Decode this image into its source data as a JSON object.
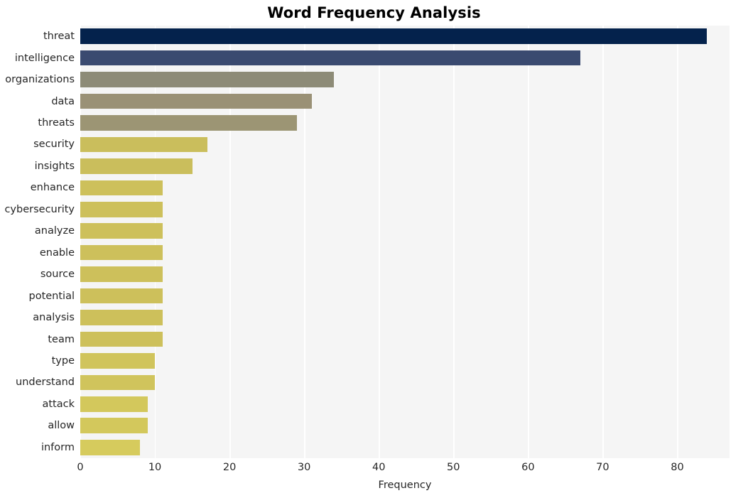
{
  "chart_data": {
    "type": "bar",
    "orientation": "horizontal",
    "title": "Word Frequency Analysis",
    "xlabel": "Frequency",
    "ylabel": "",
    "categories": [
      "threat",
      "intelligence",
      "organizations",
      "data",
      "threats",
      "security",
      "insights",
      "enhance",
      "cybersecurity",
      "analyze",
      "enable",
      "source",
      "potential",
      "analysis",
      "team",
      "type",
      "understand",
      "attack",
      "allow",
      "inform"
    ],
    "values": [
      84,
      67,
      34,
      31,
      29,
      17,
      15,
      11,
      11,
      11,
      11,
      11,
      11,
      11,
      11,
      10,
      10,
      9,
      9,
      8
    ],
    "bar_colors": [
      "#04224c",
      "#3a4a70",
      "#8d8b77",
      "#9a9176",
      "#9c9574",
      "#cabe5c",
      "#cabe5c",
      "#cdc05b",
      "#cdc05b",
      "#cdc05b",
      "#cdc05b",
      "#cdc05b",
      "#cdc05b",
      "#cdc05b",
      "#cdc05b",
      "#d0c45c",
      "#d0c45c",
      "#d3c85c",
      "#d3c85c",
      "#d6cb5d"
    ],
    "xticks": [
      0,
      10,
      20,
      30,
      40,
      50,
      60,
      70,
      80
    ],
    "xtick_labels": [
      "0",
      "10",
      "20",
      "30",
      "40",
      "50",
      "60",
      "70",
      "80"
    ],
    "xlim": [
      0,
      87
    ],
    "grid": "vertical",
    "grid_color": "#ffffff",
    "plot_background": "#f5f5f5",
    "figure_background": "#ffffff",
    "legend": "none"
  }
}
